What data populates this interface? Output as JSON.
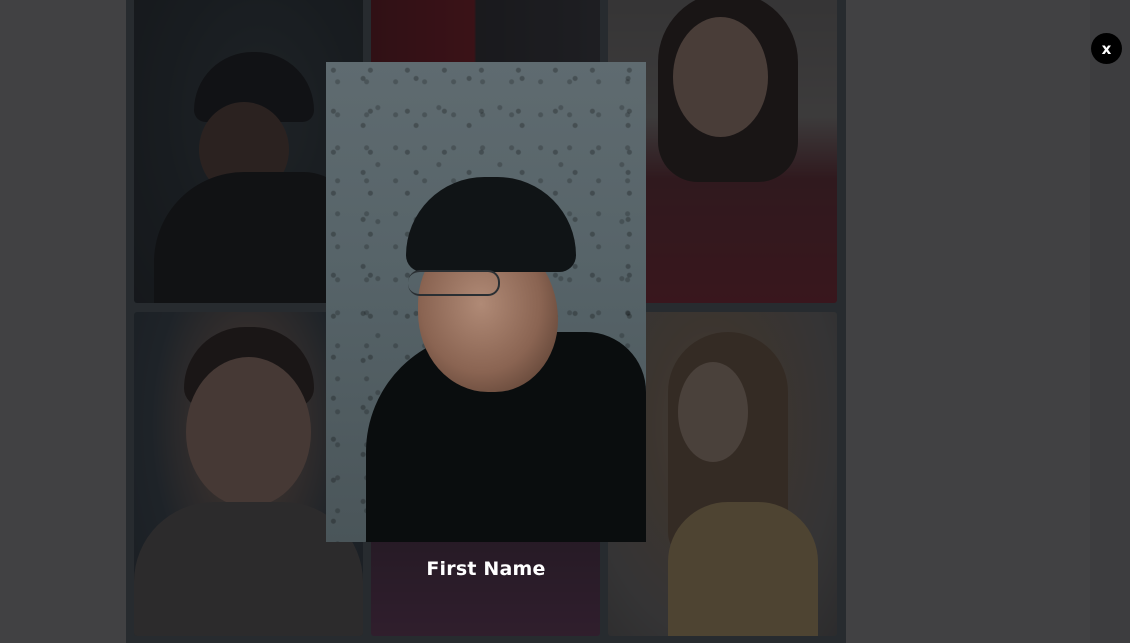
{
  "lightbox": {
    "caption": "First Name",
    "close_label": "x",
    "image_icon": "portrait-photo"
  },
  "gallery": {
    "tiles": [
      {
        "icon": "portrait-photo"
      },
      {
        "icon": "abstract-photo"
      },
      {
        "icon": "portrait-photo"
      },
      {
        "icon": "portrait-photo"
      },
      {
        "icon": "portrait-photo"
      },
      {
        "icon": "portrait-photo"
      }
    ]
  },
  "colors": {
    "overlay": "#141416",
    "close_button": "#000000",
    "caption_text": "#ffffff"
  }
}
